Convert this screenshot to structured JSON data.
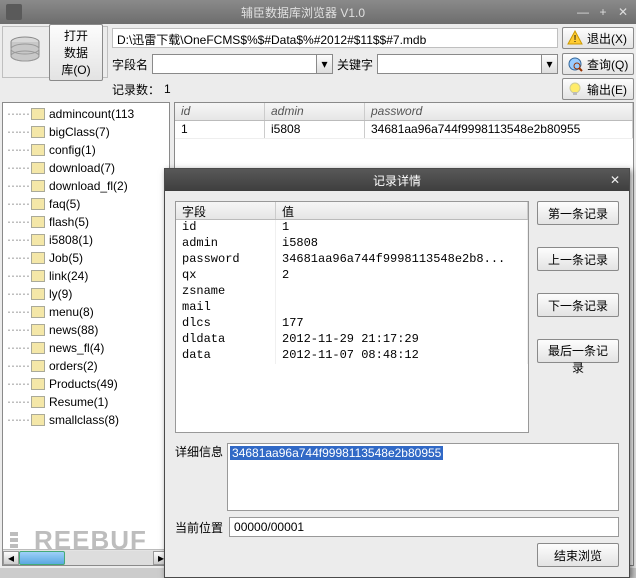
{
  "window": {
    "title": "辅臣数据库浏览器 V1.0"
  },
  "toolbar": {
    "open_db_label": "打开数据库(O)",
    "exit_label": "退出(X)",
    "query_label": "查询(Q)",
    "output_label": "输出(E)",
    "path": "D:\\迅雷下载\\OneFCMS$%$#Data$%#2012#$11$$#7.mdb",
    "field_name_label": "字段名",
    "keyword_label": "关键字",
    "record_count_label": "记录数：",
    "record_count_value": "1"
  },
  "tree": {
    "items": [
      "admincount(113",
      "bigClass(7)",
      "config(1)",
      "download(7)",
      "download_fl(2)",
      "faq(5)",
      "flash(5)",
      "i5808(1)",
      "Job(5)",
      "link(24)",
      "ly(9)",
      "menu(8)",
      "news(88)",
      "news_fl(4)",
      "orders(2)",
      "Products(49)",
      "Resume(1)",
      "smallclass(8)"
    ]
  },
  "grid": {
    "headers": [
      "id",
      "admin",
      "password"
    ],
    "row": [
      "1",
      "i5808",
      "34681aa96a744f9998113548e2b80955"
    ]
  },
  "modal": {
    "title": "记录详情",
    "field_header": "字段",
    "value_header": "值",
    "rows": [
      {
        "f": "id",
        "v": "1"
      },
      {
        "f": "admin",
        "v": "i5808"
      },
      {
        "f": "password",
        "v": "34681aa96a744f9998113548e2b8..."
      },
      {
        "f": "qx",
        "v": "2"
      },
      {
        "f": "zsname",
        "v": ""
      },
      {
        "f": "mail",
        "v": ""
      },
      {
        "f": "dlcs",
        "v": "177"
      },
      {
        "f": "dldata",
        "v": "2012-11-29 21:17:29"
      },
      {
        "f": "data",
        "v": "2012-11-07 08:48:12"
      }
    ],
    "nav": {
      "first": "第一条记录",
      "prev": "上一条记录",
      "next": "下一条记录",
      "last": "最后一条记录"
    },
    "detail_label": "详细信息",
    "detail_value": "34681aa96a744f9998113548e2b80955",
    "pos_label": "当前位置",
    "pos_value": "00000/00001",
    "end_label": "结束浏览"
  },
  "watermark": "REEBUF"
}
